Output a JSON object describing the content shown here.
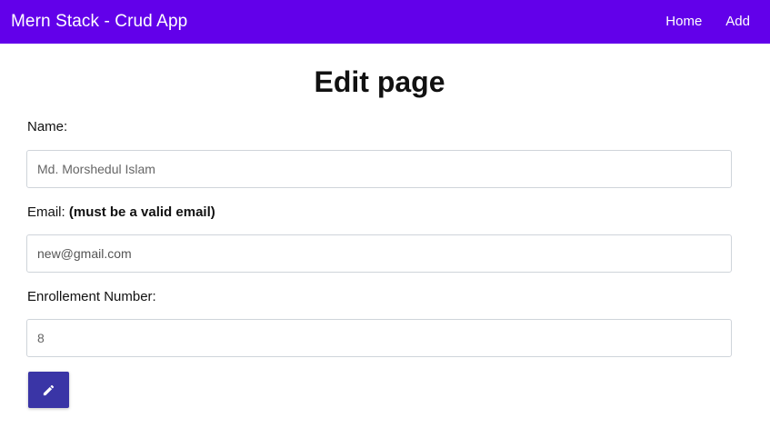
{
  "navbar": {
    "brand": "Mern Stack - Crud App",
    "links": [
      {
        "label": "Home"
      },
      {
        "label": "Add"
      }
    ],
    "color": "#6200ea"
  },
  "page": {
    "title": "Edit page"
  },
  "form": {
    "name": {
      "label": "Name:",
      "placeholder": "Md. Morshedul Islam"
    },
    "email": {
      "label": "Email:",
      "hint": "(must be a valid email)",
      "value": "new@gmail.com"
    },
    "enrollment": {
      "label": "Enrollement Number:",
      "placeholder": "8"
    },
    "submit": {
      "icon": "pencil-icon",
      "color": "#3a35a6"
    }
  }
}
